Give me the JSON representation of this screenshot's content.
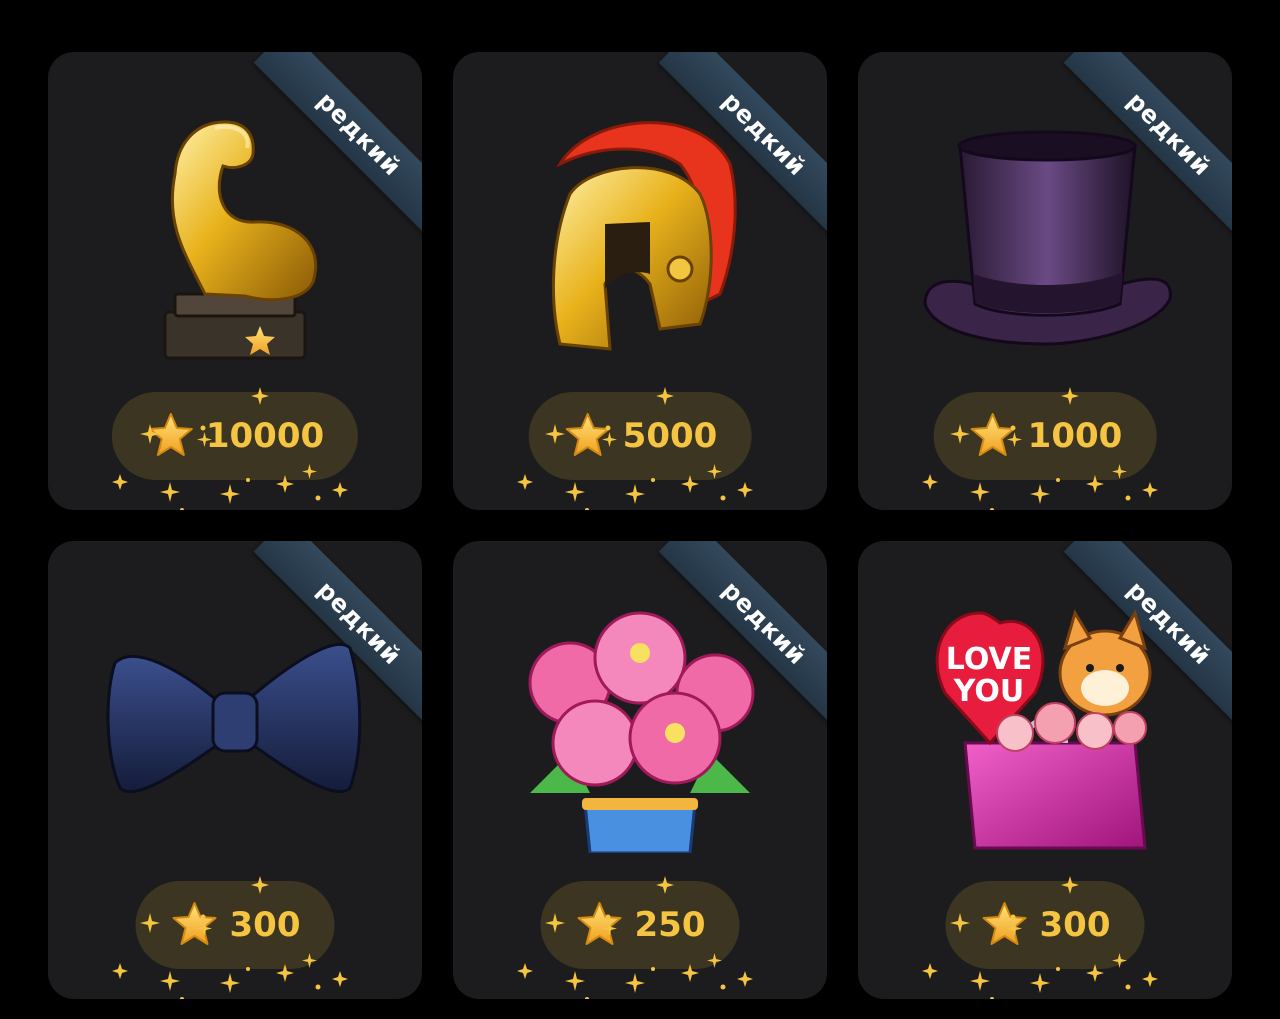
{
  "badge_label": "редкий",
  "currency_icon": "star-icon",
  "colors": {
    "page_bg": "#000000",
    "card_bg": "#1c1c1e",
    "ribbon_bg": "#2e4457",
    "price_text": "#f5c542"
  },
  "gifts": [
    {
      "name": "biceps-trophy",
      "badge": "редкий",
      "price": "10000"
    },
    {
      "name": "spartan-helmet",
      "badge": "редкий",
      "price": "5000"
    },
    {
      "name": "top-hat",
      "badge": "редкий",
      "price": "1000"
    },
    {
      "name": "bow-tie",
      "badge": "редкий",
      "price": "300"
    },
    {
      "name": "peony-bouquet",
      "badge": "редкий",
      "price": "250"
    },
    {
      "name": "love-you-gift-bag",
      "badge": "редкий",
      "price": "300"
    }
  ]
}
